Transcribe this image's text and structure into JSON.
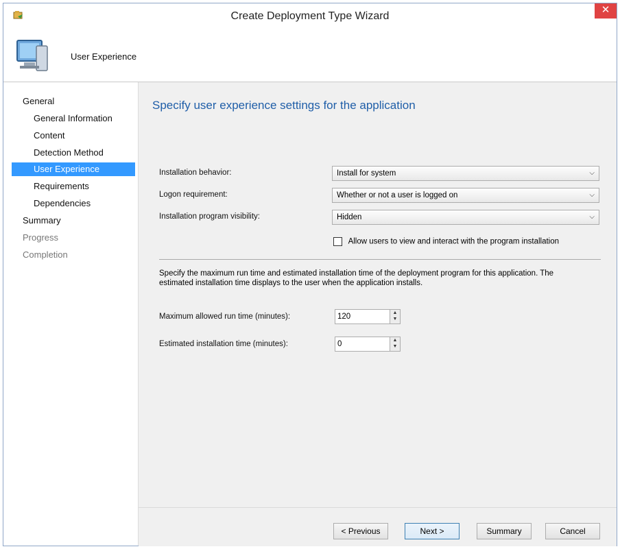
{
  "window": {
    "title": "Create Deployment Type Wizard",
    "close_glyph": "✕",
    "app_icon": "wizard-app-icon"
  },
  "header": {
    "title": "User Experience",
    "icon": "computer-icon"
  },
  "nav": {
    "items": [
      {
        "label": "General",
        "level": "top",
        "state": "normal"
      },
      {
        "label": "General Information",
        "level": "sub",
        "state": "normal"
      },
      {
        "label": "Content",
        "level": "sub",
        "state": "normal"
      },
      {
        "label": "Detection Method",
        "level": "sub",
        "state": "normal"
      },
      {
        "label": "User Experience",
        "level": "sub",
        "state": "selected"
      },
      {
        "label": "Requirements",
        "level": "sub",
        "state": "normal"
      },
      {
        "label": "Dependencies",
        "level": "sub",
        "state": "normal"
      },
      {
        "label": "Summary",
        "level": "top",
        "state": "normal"
      },
      {
        "label": "Progress",
        "level": "top",
        "state": "disabled"
      },
      {
        "label": "Completion",
        "level": "top",
        "state": "disabled"
      }
    ]
  },
  "main": {
    "heading": "Specify user experience settings for the application",
    "installation_behavior": {
      "label": "Installation behavior:",
      "value": "Install for system"
    },
    "logon_requirement": {
      "label": "Logon requirement:",
      "value": "Whether or not a user is logged on"
    },
    "program_visibility": {
      "label": "Installation program visibility:",
      "value": "Hidden"
    },
    "allow_interact": {
      "label": "Allow users to view and interact with the program installation",
      "checked": false
    },
    "description": "Specify the maximum run time and estimated installation time of the deployment program for this application. The estimated installation time displays to the user when the application installs.",
    "max_run_time": {
      "label": "Maximum allowed run time (minutes):",
      "value": "120"
    },
    "estimated_time": {
      "label": "Estimated installation time (minutes):",
      "value": "0"
    }
  },
  "footer": {
    "previous": "< Previous",
    "next": "Next >",
    "summary": "Summary",
    "cancel": "Cancel"
  },
  "colors": {
    "accent": "#3399ff",
    "heading": "#1f5ea8",
    "close": "#e04343"
  }
}
